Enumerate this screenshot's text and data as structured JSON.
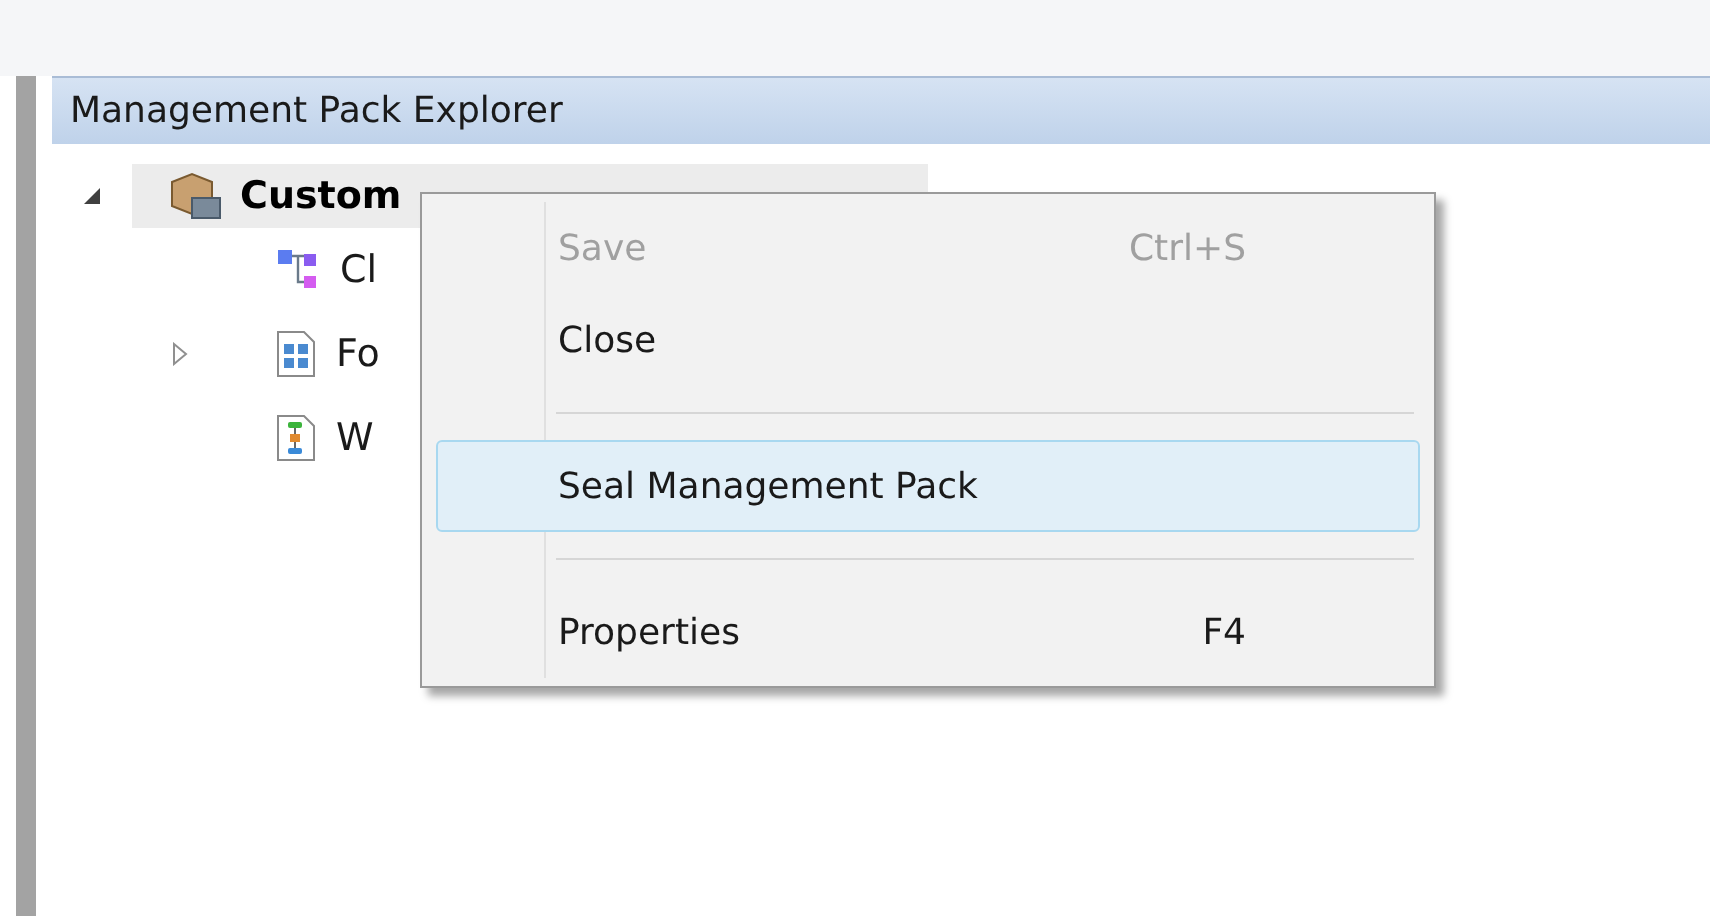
{
  "panel": {
    "title": "Management Pack Explorer"
  },
  "tree": [
    {
      "label": "Custom",
      "expanded": true,
      "selected": true,
      "children": [
        {
          "label": "Cl",
          "kind": "class",
          "expandable": false
        },
        {
          "label": "Fo",
          "kind": "form",
          "expandable": true
        },
        {
          "label": "W",
          "kind": "workflow",
          "expandable": false
        }
      ]
    }
  ],
  "context_menu": {
    "items": [
      {
        "kind": "item",
        "label": "Save",
        "shortcut": "Ctrl+S",
        "disabled": true,
        "selected": false
      },
      {
        "kind": "item",
        "label": "Close",
        "disabled": false,
        "selected": false
      },
      {
        "kind": "separator"
      },
      {
        "kind": "item",
        "label": "Seal Management Pack",
        "disabled": false,
        "selected": true
      },
      {
        "kind": "separator"
      },
      {
        "kind": "item",
        "label": "Properties",
        "shortcut": "F4",
        "disabled": false,
        "selected": false
      }
    ]
  }
}
